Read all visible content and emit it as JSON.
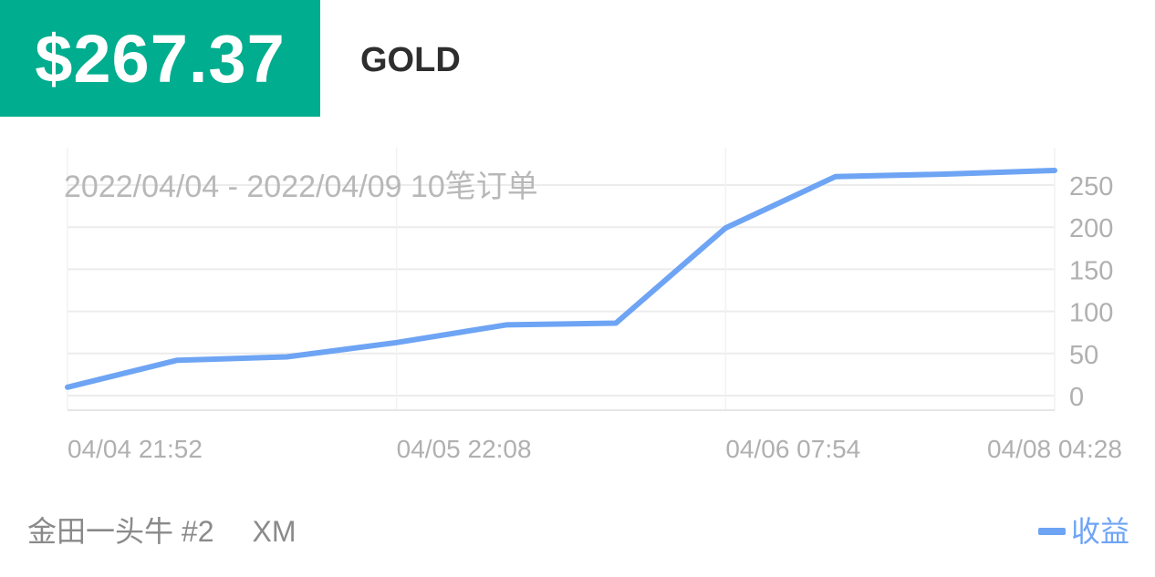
{
  "header": {
    "profit": "$267.37",
    "symbol": "GOLD"
  },
  "footer": {
    "account": "金田一头牛 #2",
    "broker": "XM"
  },
  "colors": {
    "accent": "#00ad8e",
    "line": "#6ea4f4"
  },
  "chart_data": {
    "type": "line",
    "annotation": "2022/04/04 - 2022/04/09  10笔订单",
    "x": [
      0,
      1,
      2,
      3,
      4,
      5,
      6,
      7,
      8,
      9
    ],
    "x_tick_labels": [
      {
        "at": 0,
        "label": "04/04 21:52"
      },
      {
        "at": 3,
        "label": "04/05 22:08"
      },
      {
        "at": 6,
        "label": "04/06 07:54"
      },
      {
        "at": 9,
        "label": "04/08 04:28"
      }
    ],
    "series": [
      {
        "name": "收益",
        "values": [
          10,
          42,
          46,
          63,
          84,
          86,
          199,
          260,
          263,
          267.37
        ]
      }
    ],
    "ylim": [
      0,
      270
    ],
    "y_ticks": [
      0,
      50,
      100,
      150,
      200,
      250
    ],
    "y_axis_position": "right",
    "grid": true,
    "legend": "bottom-right"
  }
}
